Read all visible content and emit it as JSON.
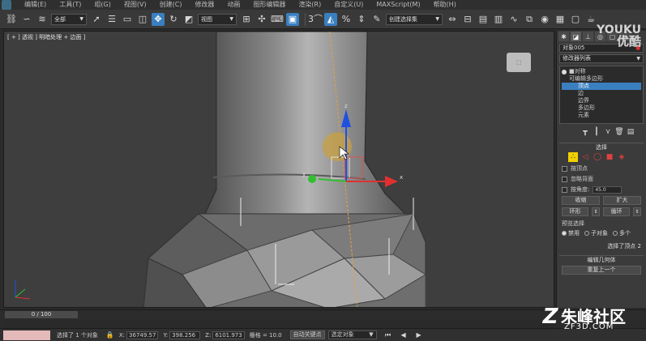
{
  "menubar": {
    "items": [
      "编辑(E)",
      "工具(T)",
      "组(G)",
      "视图(V)",
      "创建(C)",
      "修改器",
      "动画",
      "图形编辑器",
      "渲染(R)",
      "自定义(U)",
      "MAXScript(M)",
      "帮助(H)"
    ]
  },
  "toolbar": {
    "filter_select": "全部",
    "refcoord_select": "视图",
    "named_selection": "创建选择集",
    "snap_number": "3",
    "percent_label": "%"
  },
  "viewport": {
    "label": "[ + ] 透视 ] 明暗处理 + 边面 ]",
    "axis_x": "x",
    "axis_y": "y",
    "axis_z": "z"
  },
  "cmdpanel": {
    "object_name": "对象005",
    "modifier_list": "修改器列表",
    "stack": [
      {
        "label": "对称",
        "selected": false
      },
      {
        "label": "可编辑多边形",
        "selected": false
      },
      {
        "label": "顶点",
        "selected": true
      },
      {
        "label": "边",
        "selected": false
      },
      {
        "label": "边界",
        "selected": false
      },
      {
        "label": "多边形",
        "selected": false
      },
      {
        "label": "元素",
        "selected": false
      }
    ],
    "selection_title": "选择",
    "by_vertex": "按顶点",
    "ignore_backfacing": "忽略背面",
    "by_angle": "按角度:",
    "angle_value": "45.0",
    "shrink": "收缩",
    "grow": "扩大",
    "ring": "环形",
    "loop": "循环",
    "preview_selection": "预览选择",
    "preview_disable": "禁用",
    "preview_subobject": "子对象",
    "preview_multi": "多个",
    "selected_status": "选择了顶点 2",
    "edit_geometry_title": "编辑几何体",
    "repeat_last": "重复上一个"
  },
  "timeline": {
    "frame_label": "0 / 100"
  },
  "statusbar": {
    "message": "选择了 1 个对象",
    "x_label": "X:",
    "x_value": "36749.57",
    "y_label": "Y:",
    "y_value": "398.256",
    "z_label": "Z:",
    "z_value": "6101.973",
    "grid_label": "栅格 = 10.0",
    "auto_key": "自动关键点",
    "selection_set": "选定对象"
  },
  "watermarks": {
    "youku": "YOUKU",
    "youku_cn": "优酷",
    "zf_brand": "朱峰社区",
    "zf_url": "ZF3D.COM"
  },
  "colors": {
    "accent": "#3a7fc0",
    "viewport_bg": "#3e3e3e",
    "subobject_active": "#f0d000",
    "gizmo_x": "#e03030",
    "gizmo_y": "#30c030",
    "gizmo_z": "#2050e0"
  }
}
